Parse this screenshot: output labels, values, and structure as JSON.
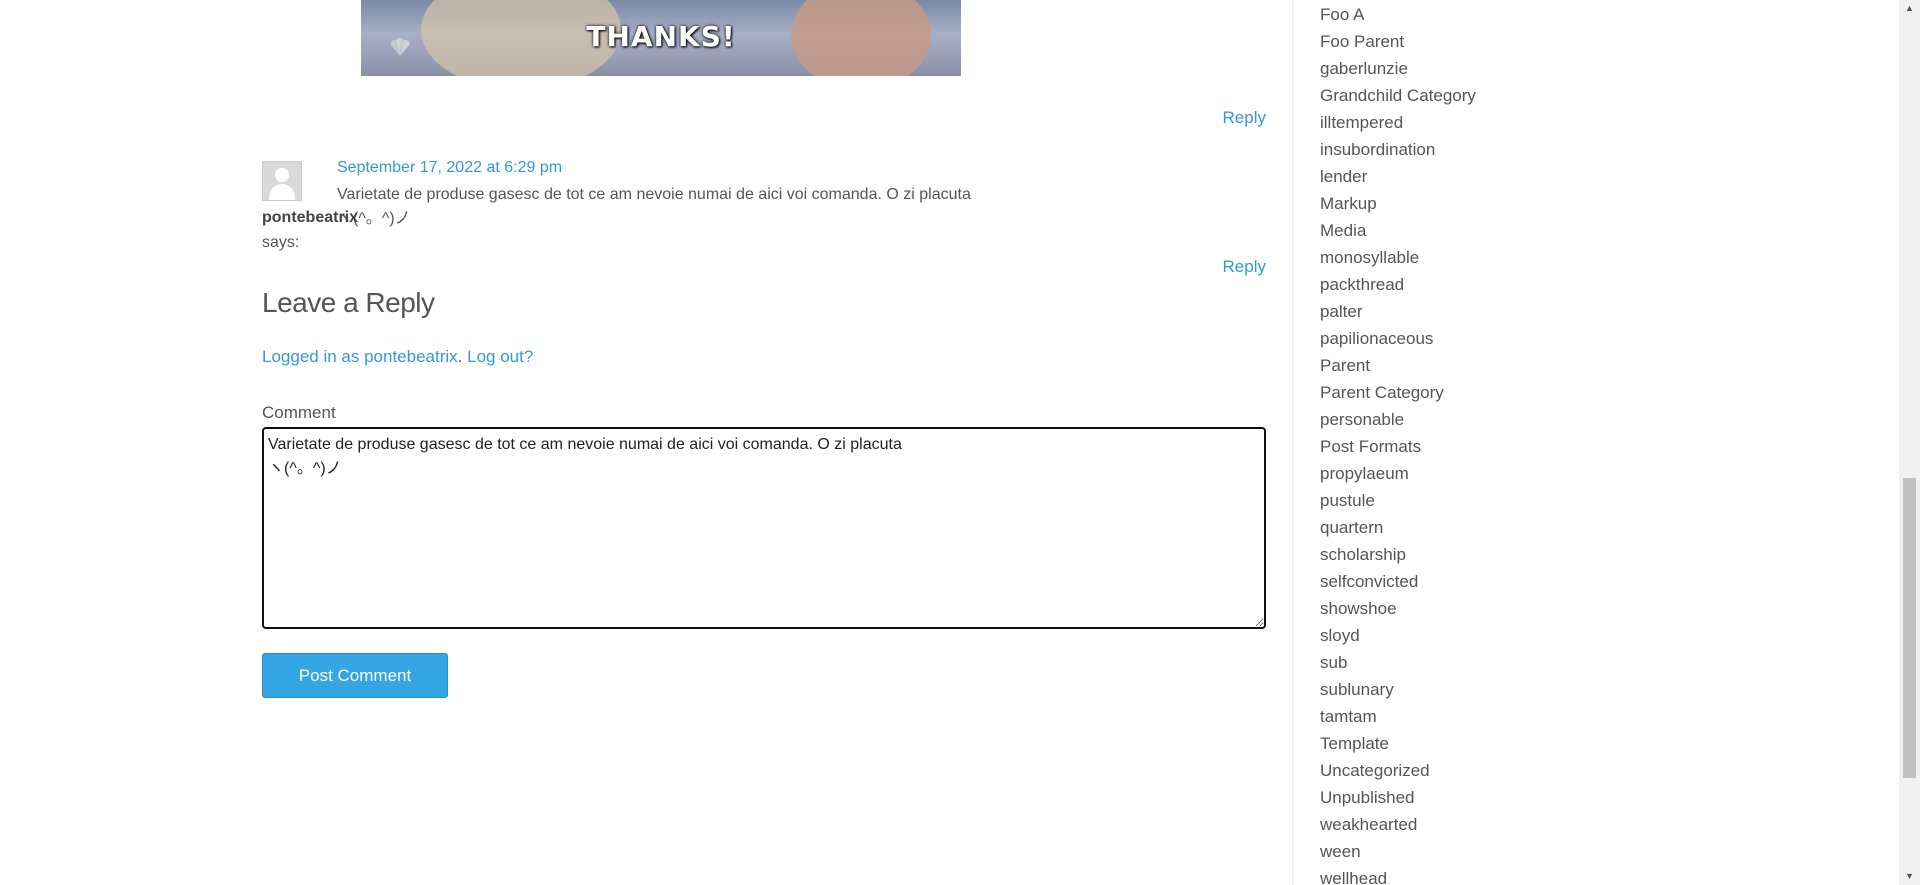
{
  "gif": {
    "caption": "THANKS!"
  },
  "replies": {
    "reply_label": "Reply"
  },
  "comment": {
    "date": "September 17, 2022 at 6:29 pm",
    "text": "Varietate de produse gasesc de tot ce am nevoie numai de aici voi comanda. O zi placuta\nヽ(^。^)ノ",
    "author": "pontebeatrix",
    "says": "says:"
  },
  "reply_form": {
    "title": "Leave a Reply",
    "logged_in_link": "Logged in as pontebeatrix",
    "separator": ".",
    "logout_link": "Log out?",
    "comment_label": "Comment",
    "comment_value": "Varietate de produse gasesc de tot ce am nevoie numai de aici voi comanda. O zi placuta\nヽ(^。^)ノ",
    "submit_label": "Post Comment"
  },
  "sidebar": {
    "categories": [
      "Foo A",
      "Foo Parent",
      "gaberlunzie",
      "Grandchild Category",
      "illtempered",
      "insubordination",
      "lender",
      "Markup",
      "Media",
      "monosyllable",
      "packthread",
      "palter",
      "papilionaceous",
      "Parent",
      "Parent Category",
      "personable",
      "Post Formats",
      "propylaeum",
      "pustule",
      "quartern",
      "scholarship",
      "selfconvicted",
      "showshoe",
      "sloyd",
      "sub",
      "sublunary",
      "tamtam",
      "Template",
      "Uncategorized",
      "Unpublished",
      "weakhearted",
      "ween",
      "wellhead"
    ]
  },
  "colors": {
    "link": "#3498db",
    "button": "#34a6e4",
    "text": "#555555"
  }
}
